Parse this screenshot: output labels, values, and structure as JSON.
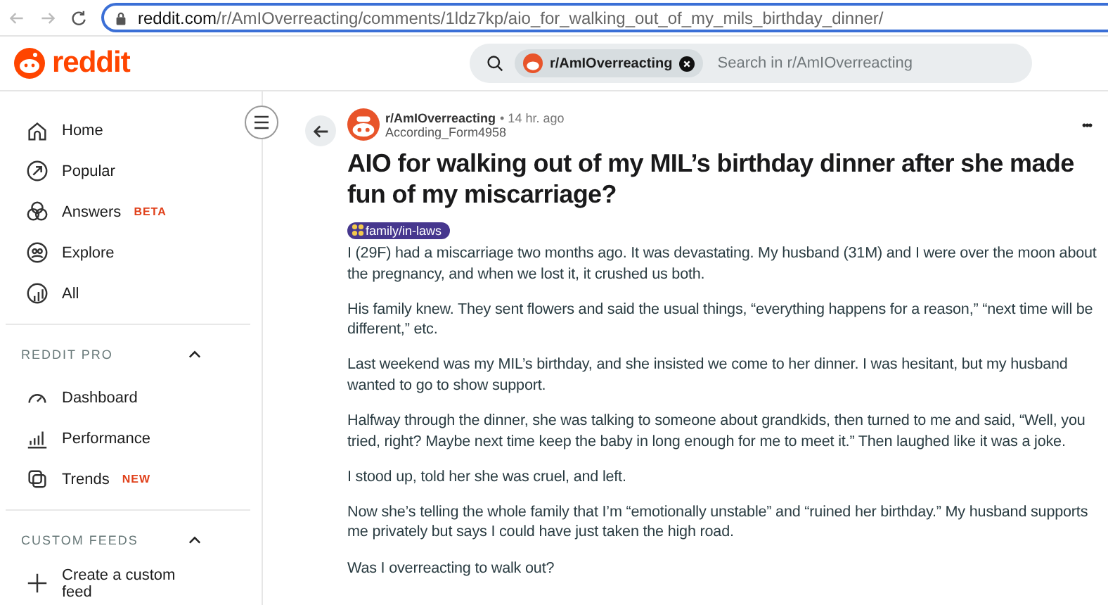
{
  "browser": {
    "url_host": "reddit.com",
    "url_path": "/r/AmIOverreacting/comments/1ldz7kp/aio_for_walking_out_of_my_mils_birthday_dinner/"
  },
  "header": {
    "logo": "reddit",
    "search_chip": "r/AmIOverreacting",
    "search_placeholder": "Search in r/AmIOverreacting"
  },
  "sidebar": {
    "items": [
      {
        "label": "Home"
      },
      {
        "label": "Popular"
      },
      {
        "label": "Answers",
        "badge": "BETA"
      },
      {
        "label": "Explore"
      },
      {
        "label": "All"
      }
    ],
    "sections": [
      {
        "title": "REDDIT PRO",
        "expanded": true,
        "items": [
          {
            "label": "Dashboard"
          },
          {
            "label": "Performance"
          },
          {
            "label": "Trends",
            "badge": "NEW"
          }
        ]
      },
      {
        "title": "CUSTOM FEEDS",
        "expanded": true,
        "items": [
          {
            "label": "Create a custom feed"
          }
        ]
      }
    ]
  },
  "post": {
    "subreddit": "r/AmIOverreacting",
    "time": "• 14 hr. ago",
    "author": "According_Form4958",
    "more": "•••",
    "title": "AIO for walking out of my MIL’s birthday dinner after she made fun of my miscarriage?",
    "flair": "family/in-laws",
    "paragraphs": [
      "I (29F) had a miscarriage two months ago. It was devastating. My husband (31M) and I were over the moon about the pregnancy, and when we lost it, it crushed us both.",
      "His family knew. They sent flowers and said the usual things, “everything happens for a reason,” “next time will be different,” etc.",
      "Last weekend was my MIL’s birthday, and she insisted we come to her dinner. I was hesitant, but my husband wanted to go to show support.",
      "Halfway through the dinner, she was talking to someone about grandkids, then turned to me and said, “Well, you tried, right? Maybe next time keep the baby in long enough for me to meet it.” Then laughed like it was a joke.",
      "I stood up, told her she was cruel, and left.",
      "Now she’s telling the whole family that I’m “emotionally unstable” and “ruined her birthday.” My husband supports me privately but says I could have just taken the high road.",
      "Was I overreacting to walk out?"
    ]
  }
}
